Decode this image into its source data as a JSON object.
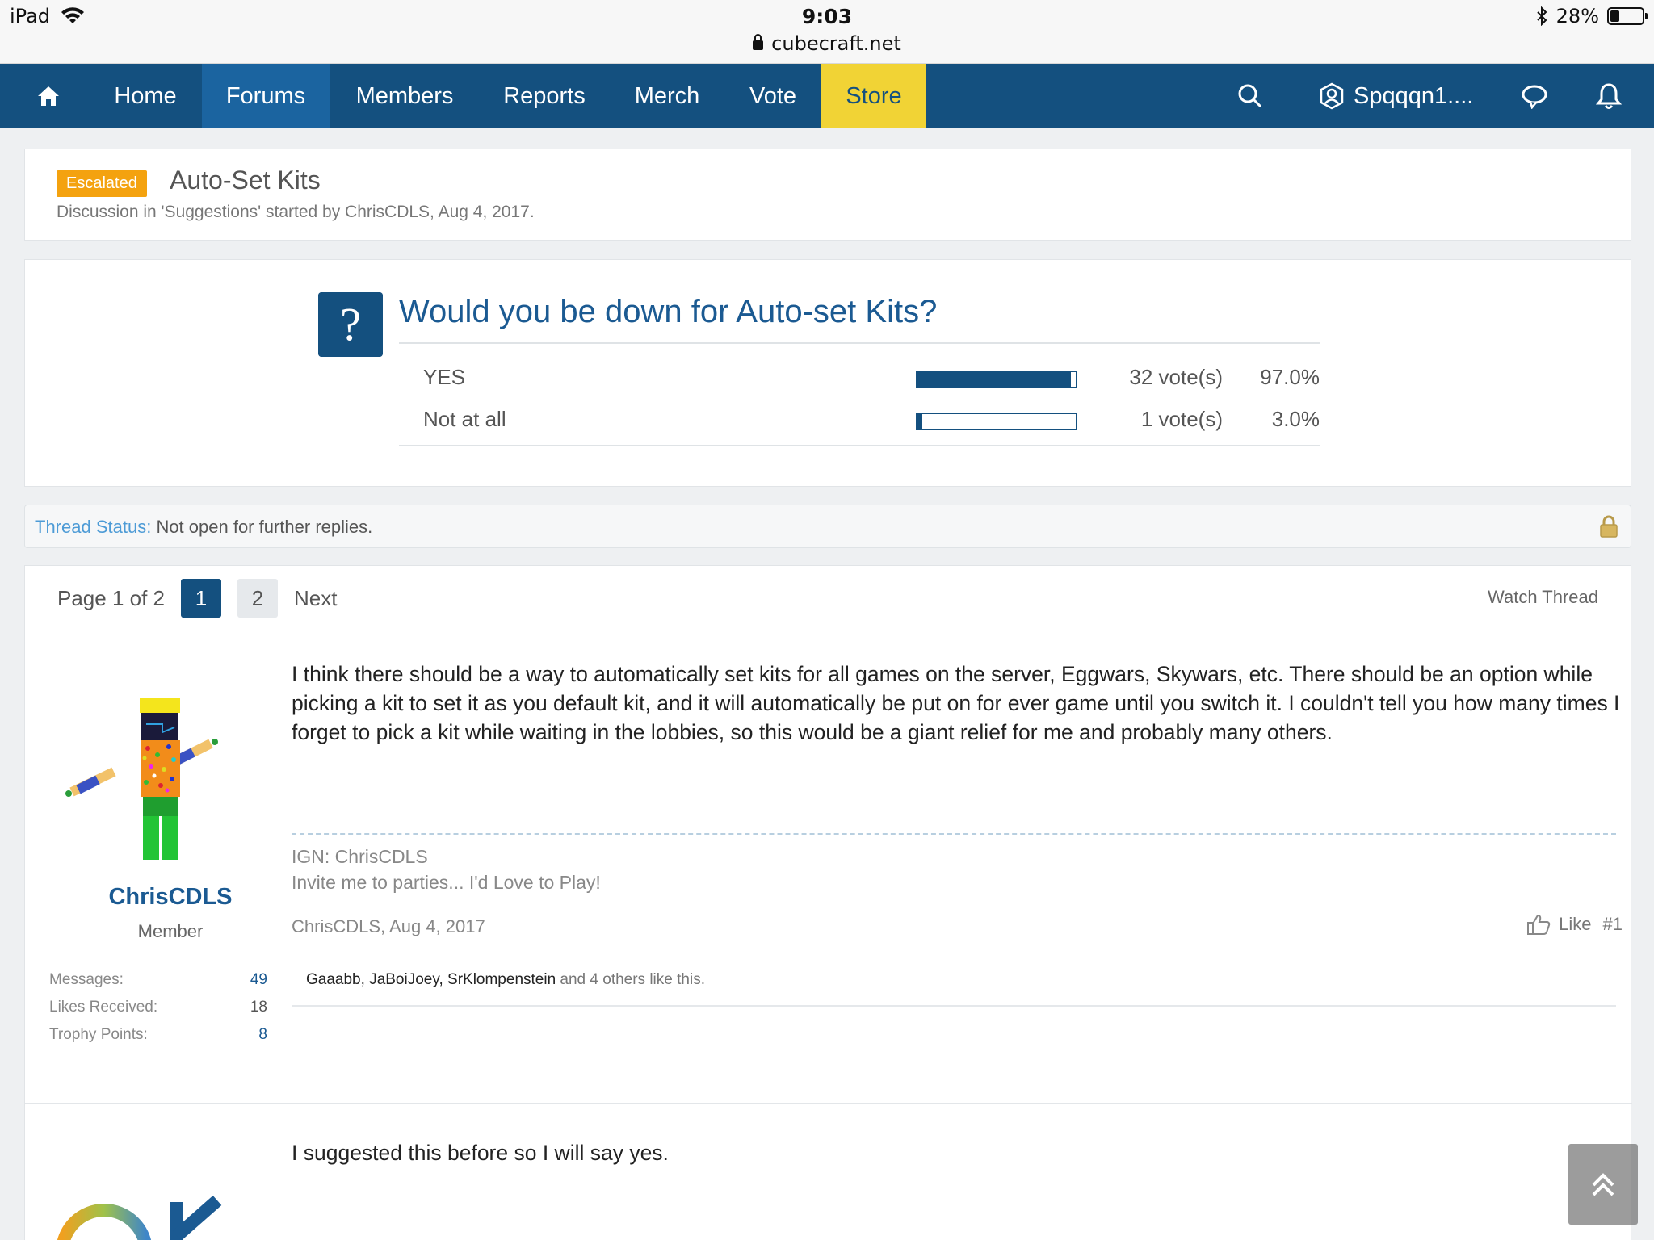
{
  "status_bar": {
    "device": "iPad",
    "time": "9:03",
    "url": "cubecraft.net",
    "battery": "28%",
    "battery_level": 0.28
  },
  "nav": {
    "items": [
      {
        "label": "Home"
      },
      {
        "label": "Forums"
      },
      {
        "label": "Members"
      },
      {
        "label": "Reports"
      },
      {
        "label": "Merch"
      },
      {
        "label": "Vote"
      },
      {
        "label": "Store"
      }
    ],
    "active": "Forums",
    "user": "Spqqqn1....",
    "colors": {
      "bar": "#14507f",
      "active": "#1b64a0",
      "store": "#f1d335"
    }
  },
  "thread": {
    "prefix": "Escalated",
    "title": "Auto-Set Kits",
    "meta": "Discussion in 'Suggestions' started by ChrisCDLS, Aug 4, 2017."
  },
  "poll": {
    "question": "Would you be down for Auto-set Kits?",
    "options": [
      {
        "label": "YES",
        "votes": "32 vote(s)",
        "percent": "97.0%",
        "fraction": 0.97
      },
      {
        "label": "Not at all",
        "votes": "1 vote(s)",
        "percent": "3.0%",
        "fraction": 0.03
      }
    ]
  },
  "thread_status": {
    "label": "Thread Status:",
    "value": "Not open for further replies."
  },
  "pagination": {
    "label": "Page 1 of 2",
    "pages": [
      "1",
      "2"
    ],
    "current": "1",
    "next": "Next",
    "watch": "Watch Thread"
  },
  "posts": [
    {
      "username": "ChrisCDLS",
      "user_title": "Member",
      "stats": [
        {
          "label": "Messages:",
          "value": "49"
        },
        {
          "label": "Likes Received:",
          "value": "18"
        },
        {
          "label": "Trophy Points:",
          "value": "8"
        }
      ],
      "body": "I think there should be a way to automatically set kits for all games on the server, Eggwars, Skywars, etc. There should be an option while picking a kit to set it as you default kit, and it will automatically be put on for ever game until you switch it. I couldn't tell you how many times I forget to pick a kit while waiting in the lobbies, so this would be a giant relief for me and probably many others.",
      "signature": [
        "IGN: ChrisCDLS",
        "Invite me to parties... I'd Love to Play!"
      ],
      "meta": "ChrisCDLS, Aug 4, 2017",
      "like_label": "Like",
      "post_number": "#1",
      "likers": [
        "Gaaabb",
        "JaBoiJoey",
        "SrKlompenstein"
      ],
      "likes_suffix": "and 4 others like this."
    },
    {
      "body": "I suggested this before so I will say yes."
    }
  ]
}
